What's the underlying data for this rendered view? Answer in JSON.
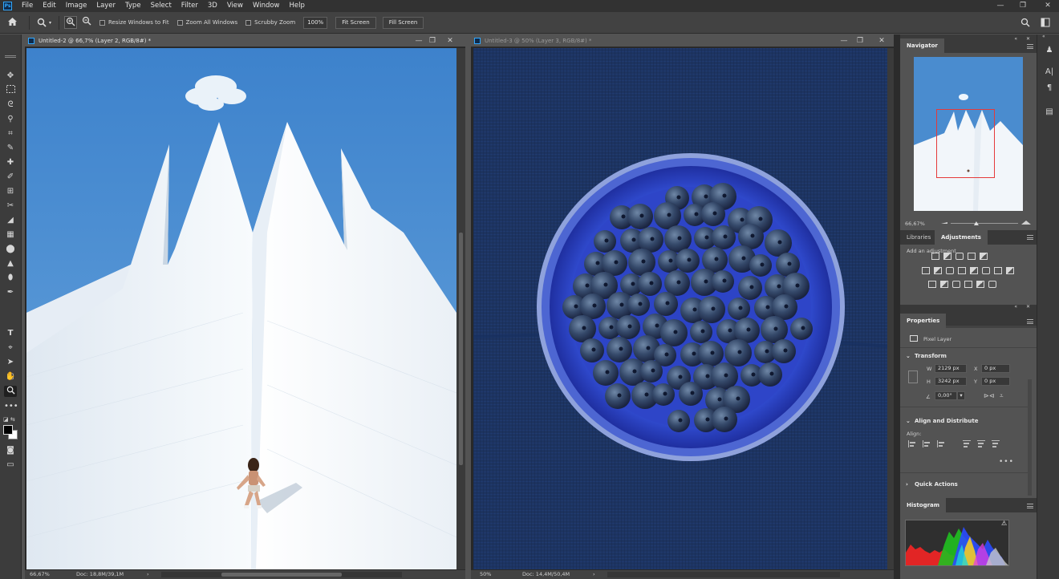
{
  "menu": {
    "logo": "Ps",
    "items": [
      "File",
      "Edit",
      "Image",
      "Layer",
      "Type",
      "Select",
      "Filter",
      "3D",
      "View",
      "Window",
      "Help"
    ]
  },
  "window_controls": {
    "minimize": "—",
    "restore": "❐",
    "close": "✕"
  },
  "options_bar": {
    "home_icon": "home-icon",
    "zoom_tool_icon": "zoom-icon",
    "zoom_in_icon": "zoom-in-icon",
    "zoom_out_icon": "zoom-out-icon",
    "resize_windows": {
      "label": "Resize Windows to Fit",
      "checked": false
    },
    "zoom_all_windows": {
      "label": "Zoom All Windows",
      "checked": false
    },
    "scrubby_zoom": {
      "label": "Scrubby Zoom",
      "checked": false
    },
    "zoom_value": "100%",
    "fit_screen": "Fit Screen",
    "fill_screen": "Fill Screen"
  },
  "tools": [
    "move-tool-icon",
    "marquee-tool-icon",
    "lasso-tool-icon",
    "magic-wand-tool-icon",
    "crop-tool-icon",
    "eyedropper-tool-icon",
    "spot-healing-tool-icon",
    "brush-tool-icon",
    "clone-stamp-tool-icon",
    "history-brush-tool-icon",
    "eraser-tool-icon",
    "gradient-tool-icon",
    "blur-tool-icon",
    "dodge-tool-icon",
    "pen-tool-icon",
    "type-tool-icon",
    "path-selection-tool-icon",
    "shape-tool-icon",
    "hand-tool-icon",
    "zoom-tool-icon"
  ],
  "documents": [
    {
      "title": "Untitled-2 @ 66,7% (Layer 2, RGB/8#) *",
      "zoom": "66,67%",
      "doc_size": "Doc: 18,8M/39,1M",
      "active": true
    },
    {
      "title": "Untitled-3 @ 50% (Layer 3, RGB/8#) *",
      "zoom": "50%",
      "doc_size": "Doc: 14,4M/50,4M",
      "active": false
    }
  ],
  "navigator": {
    "title": "Navigator",
    "zoom": "66,67%",
    "zoom_slider_fraction": 0.38
  },
  "libraries_tab": "Libraries",
  "adjustments": {
    "tab": "Adjustments",
    "hint": "Add an adjustment"
  },
  "properties": {
    "title": "Properties",
    "layer_type": "Pixel Layer",
    "transform_header": "Transform",
    "w_label": "W",
    "w_value": "2129 px",
    "h_label": "H",
    "h_value": "3242 px",
    "x_label": "X",
    "x_value": "0 px",
    "y_label": "Y",
    "y_value": "0 px",
    "angle_value": "0,00°",
    "align_header": "Align and Distribute",
    "align_label": "Align:",
    "more": "•••",
    "quick_actions": "Quick Actions"
  },
  "histogram": {
    "title": "Histogram",
    "warning": "⚠"
  },
  "colors": {
    "app_bg": "#535353",
    "menubar": "#323232",
    "panel": "#424242",
    "accent_blue": "#31a8ff",
    "sky": "#4d8fd0",
    "tent": "#f2f6fa",
    "linen": "#1e3563",
    "plate": "#2f48c8",
    "berry": "#2b3d5a"
  }
}
